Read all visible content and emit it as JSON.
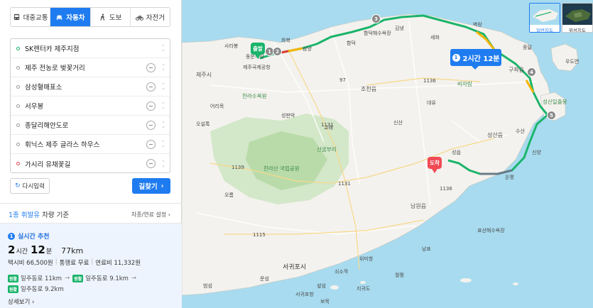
{
  "mode_tabs": [
    {
      "label": "대중교통",
      "icon": "bus-icon",
      "active": false
    },
    {
      "label": "자동차",
      "icon": "car-icon",
      "active": true
    },
    {
      "label": "도보",
      "icon": "walk-icon",
      "active": false
    },
    {
      "label": "자전거",
      "icon": "bicycle-icon",
      "active": false
    }
  ],
  "waypoints": [
    {
      "label": "SK렌터카 제주지점",
      "type": "start"
    },
    {
      "label": "제주 전농로 벚꽃거리",
      "type": "via"
    },
    {
      "label": "삼성혈매표소",
      "type": "via"
    },
    {
      "label": "서우봉",
      "type": "via"
    },
    {
      "label": "종달리해안도로",
      "type": "via"
    },
    {
      "label": "휘닉스 제주 글라스 하우스",
      "type": "via"
    },
    {
      "label": "가시리 유채꽃길",
      "type": "end"
    }
  ],
  "buttons": {
    "reset": "다시입력",
    "find_route": "길찾기"
  },
  "vehicle": {
    "type_prefix": "1종",
    "type_name": "휘발유",
    "type_suffix": "차량 기준",
    "settings": "차종/연료 설정"
  },
  "result": {
    "badge": "1",
    "label": "실시간 추천",
    "hours": "2",
    "hours_unit": "시간",
    "minutes": "12",
    "minutes_unit": "분",
    "distance": "77km",
    "taxi": "택시비 66,500원",
    "toll": "통행료 무료",
    "fuel": "연료비 11,332원",
    "roads_line1": [
      {
        "tag": "원활",
        "text": "일주동로 11km"
      },
      {
        "tag": "원활",
        "text": "일주동로 9.1km"
      }
    ],
    "roads_line2": [
      {
        "tag": "원활",
        "text": "일주동로 9.2km"
      }
    ],
    "detail": "상세보기"
  },
  "map": {
    "tooltip": {
      "num": "1",
      "text": "2시간 12분"
    },
    "start_pin": "출발",
    "end_pin": "도착",
    "waypoint_markers": [
      "1",
      "2",
      "3",
      "4",
      "5"
    ],
    "map_types": [
      {
        "label": "일반지도",
        "active": true
      },
      {
        "label": "위성지도",
        "active": false
      }
    ],
    "places": {
      "jocheon": "조천읍",
      "gujwa": "구좌읍",
      "seongsan": "성산읍",
      "namwon": "남원읍",
      "seogwipo": "서귀포시",
      "hallasan": "한라산 국립공원",
      "jeju_airport": "제주국제공항",
      "hamdeok": "함덕해수욕장",
      "bijarim": "비자림",
      "seongsan_ilchulbong": "성산일출봉",
      "udo": "우도면",
      "sanggumburi": "산굼부리",
      "seongeup": "성읍",
      "pyoseon": "표선해수욕장",
      "wimi": "위미항",
      "soesokkak": "쇠소깍",
      "jigwido": "지귀도",
      "seopseom": "섶섬",
      "beomseom": "범섬",
      "munseom": "문섬",
      "wolpyeong": "월평",
      "bomok": "보목",
      "sinsan": "신산",
      "gyorae": "교래",
      "hallasan_park": "한라수목원",
      "jeju_market": "동문시장",
      "sangmyeong": "삼양",
      "hwabuk": "화북",
      "gimnyeong": "김녕",
      "sehwa": "세화",
      "jongdal": "종달",
      "sinyang": "신양",
      "nampyo": "남표",
      "byeokrang": "벽랑",
      "osulloc": "오설록",
      "eorimok": "어리목",
      "seongpanak": "성판악",
      "orumok": "오름",
      "hamdeok_beach": "함덕",
      "sarabong": "사라봉",
      "jeju_city": "제주시",
      "daeyu": "대유",
      "susan": "수산",
      "onpyeong": "온평",
      "seoguipo_port": "서귀포항",
      "road_97": "97",
      "road_1136a": "1136",
      "road_1136b": "1136",
      "road_1131a": "1131",
      "road_1131b": "1131",
      "road_1139": "1139",
      "road_1115": "1115"
    }
  }
}
